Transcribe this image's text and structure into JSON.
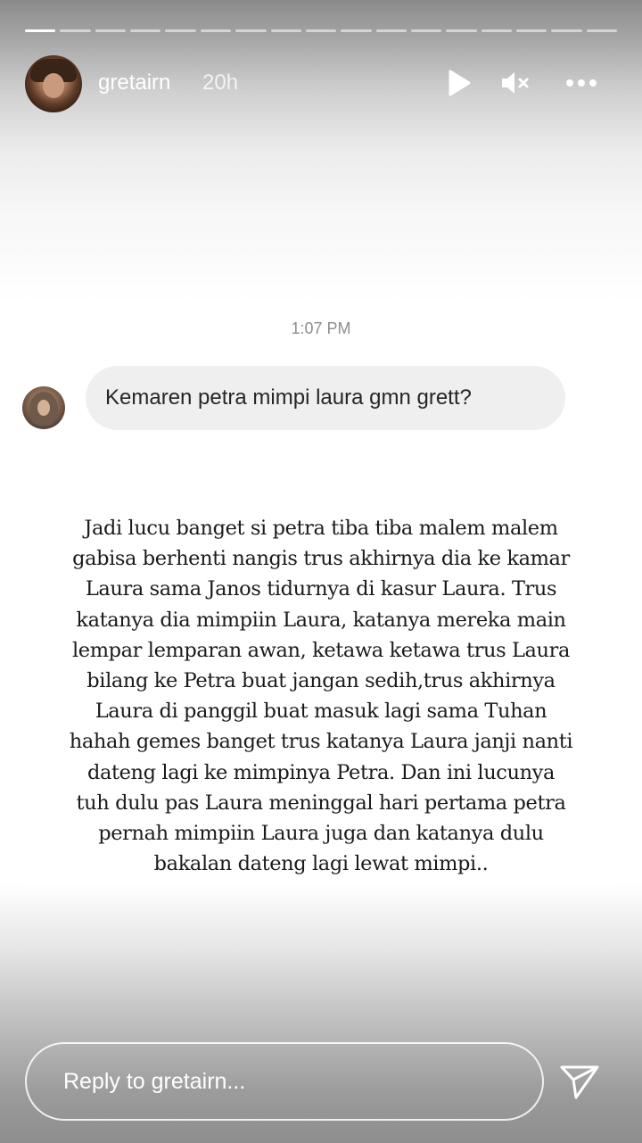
{
  "story": {
    "progress_total": 17,
    "progress_done": 1,
    "username": "gretairn",
    "time_ago": "20h",
    "icons": {
      "play": "play-icon",
      "mute": "speaker-muted-icon",
      "more": "more-icon",
      "send": "send-icon"
    }
  },
  "chat": {
    "timestamp": "1:07 PM",
    "message": "Kemaren petra mimpi laura gmn grett?"
  },
  "caption": {
    "lines": [
      "Jadi lucu banget si petra tiba tiba malem malem",
      "gabisa berhenti nangis trus akhirnya dia ke kamar",
      "Laura sama Janos tidurnya di kasur Laura. Trus",
      "katanya dia mimpiin Laura, katanya mereka main",
      "lempar lemparan awan, ketawa ketawa trus Laura",
      "bilang ke Petra buat jangan sedih,trus akhirnya",
      "Laura di panggil buat masuk lagi sama Tuhan",
      "hahah gemes banget trus katanya Laura janji nanti",
      "dateng lagi ke mimpinya Petra. Dan ini lucunya",
      "tuh dulu pas Laura meninggal hari pertama petra",
      "pernah mimpiin Laura juga dan katanya dulu",
      "bakalan dateng lagi lewat mimpi.."
    ]
  },
  "reply": {
    "placeholder": "Reply to gretairn..."
  }
}
